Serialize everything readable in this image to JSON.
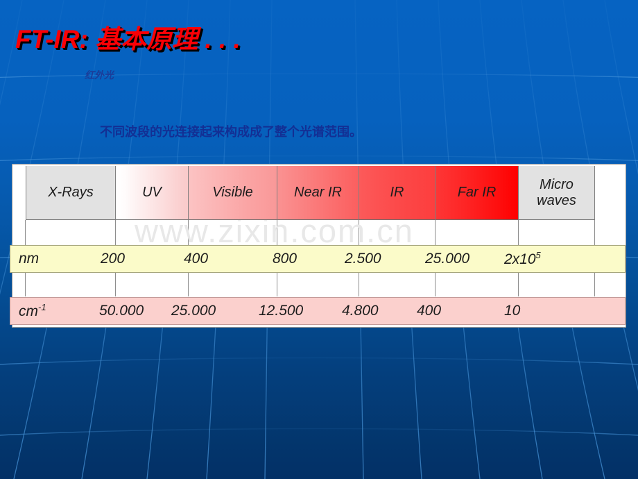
{
  "slide": {
    "title": "FT-IR: 基本原理 . . .",
    "caption": "红外光",
    "subtitle": "不同波段的光连接起来构成成了整个光谱范围。",
    "watermark": "www.zixin.com.cn",
    "background_color": "#0663c2",
    "title_color": "#fb0005",
    "subtitle_color": "#132f94"
  },
  "spectrum_table": {
    "bands": [
      {
        "label": "X-Rays",
        "fill": "#e2e2e2"
      },
      {
        "label": "UV",
        "fill": "gradient-uv"
      },
      {
        "label": "Visible",
        "fill": "gradient-visible"
      },
      {
        "label": "Near IR",
        "fill": "gradient-nearir"
      },
      {
        "label": "IR",
        "fill": "gradient-ir"
      },
      {
        "label": "Far IR",
        "fill": "gradient-farir"
      },
      {
        "label": "Micro waves",
        "fill": "#e2e2e2"
      }
    ],
    "rows": [
      {
        "unit": "nm",
        "unit_sup": "",
        "background": "#fbfbc9",
        "values": [
          "200",
          "400",
          "800",
          "2.500",
          "25.000",
          "2x10"
        ],
        "last_value_sup": "5"
      },
      {
        "unit": "cm",
        "unit_sup": "-1",
        "background": "#fbd0cd",
        "values": [
          "50.000",
          "25.000",
          "12.500",
          "4.800",
          "400",
          "10"
        ],
        "last_value_sup": ""
      }
    ]
  }
}
